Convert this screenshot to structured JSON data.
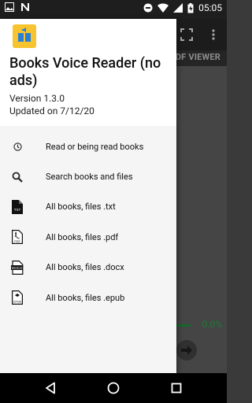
{
  "status_bar": {
    "time": "05:05",
    "left_icons": [
      "image-icon",
      "n-notification-icon"
    ],
    "right_icons": [
      "minus-circle-icon",
      "wifi-icon",
      "signal-icon",
      "battery-icon"
    ]
  },
  "background_app": {
    "tab_label": "PDF VIEWER",
    "progress_text": "0.0%",
    "toolbar_icons": [
      "fullscreen-icon",
      "more-vert-icon"
    ],
    "colors": {
      "progress": "#1ea442",
      "progress_text": "#26c04d"
    }
  },
  "drawer": {
    "title": "Books Voice Reader (no ads)",
    "version": "Version 1.3.0",
    "updated": "Updated on 7/12/20",
    "menu": [
      {
        "icon": "clock-icon",
        "label": "Read or being read books"
      },
      {
        "icon": "search-icon",
        "label": "Search books and files"
      },
      {
        "icon": "txt-file-icon",
        "label": "All books, files .txt"
      },
      {
        "icon": "pdf-file-icon",
        "label": "All books, files .pdf"
      },
      {
        "icon": "docx-file-icon",
        "label": "All books, files .docx"
      },
      {
        "icon": "epub-file-icon",
        "label": "All books, files .epub"
      }
    ]
  },
  "nav_bar": {
    "buttons": [
      "back-icon",
      "home-icon",
      "recents-icon"
    ]
  }
}
